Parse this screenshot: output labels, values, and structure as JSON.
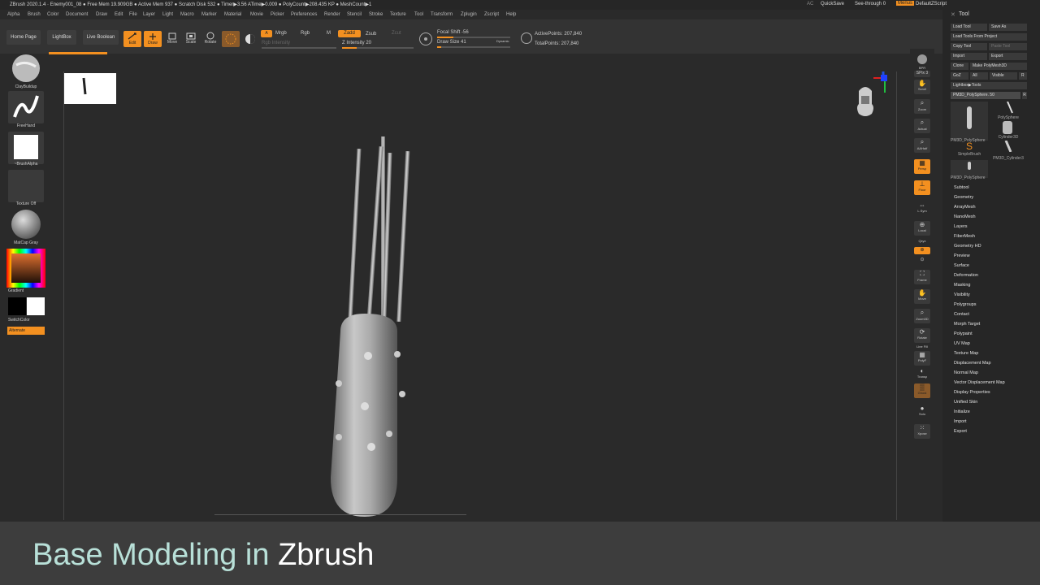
{
  "titlebar": {
    "text": "ZBrush 2020.1.4  ·  Enemy001_08  ●  Free Mem 19.909GB  ●  Active Mem 937  ●  Scratch Disk 532  ●  Timer▶3.56 ATime▶0.009  ●  PolyCount▶208.435 KP  ●  MeshCount▶1",
    "ac": "AC",
    "quicksave": "QuickSave",
    "seethrough": "See-through  0",
    "menus": "Menus",
    "script": "DefaultZScript"
  },
  "menubar": [
    "Alpha",
    "Brush",
    "Color",
    "Document",
    "Draw",
    "Edit",
    "File",
    "Layer",
    "Light",
    "Macro",
    "Marker",
    "Material",
    "Movie",
    "Picker",
    "Preferences",
    "Render",
    "Stencil",
    "Stroke",
    "Texture",
    "Tool",
    "Transform",
    "Zplugin",
    "Zscript",
    "Help"
  ],
  "toolbar": {
    "home": "Home Page",
    "lightbox": "LightBox",
    "liveboolean": "Live Boolean",
    "edit": "Edit",
    "draw": "Draw",
    "move": "Move",
    "scale": "Scale",
    "rotate": "Rotate",
    "a": "A",
    "mrgb": "Mrgb",
    "rgb": "Rgb",
    "m": "M",
    "zadd": "Zadd",
    "zsub": "Zsub",
    "zcut": "Zcut",
    "rgb_intensity": "Rgb Intensity",
    "z_intensity": "Z Intensity 20",
    "focal_shift": "Focal Shift -56",
    "draw_size": "Draw Size 41",
    "dynamic": "Dynamic",
    "active_points": "ActivePoints: 207,840",
    "total_points": "TotalPoints: 207,840",
    "z_intensity_value": 0.2,
    "focal_shift_value": 0.22,
    "draw_size_value": 0.05
  },
  "leftshelf": {
    "brush1": "ClayBuildup",
    "brush2": "FreeHand",
    "alpha": "~BrushAlpha",
    "texture": "Texture Off",
    "material": "MatCap Gray",
    "gradient": "Gradient",
    "switchcolor": "SwitchColor",
    "alternate": "Alternate"
  },
  "rightshelf": {
    "bpr": "BPR",
    "spix": "SPix 3",
    "scroll": "Scroll",
    "zoom": "Zoom",
    "actual": "Actual",
    "aahalf": "AAHalf",
    "persp": "Persp",
    "floor": "Floor",
    "lsym": "L.Sym",
    "local": "Local",
    "qxyz": "Qxyz",
    "frame": "Frame",
    "move": "Move",
    "zoom3d": "Zoom3D",
    "rotate": "Rotate",
    "linefill": "Line Fill",
    "polyf": "PolyF",
    "transp": "Transp",
    "ghost": "Ghost",
    "solo": "Solo",
    "xpose": "Xpose"
  },
  "toolpanel": {
    "title": "Tool",
    "load_tool": "Load Tool",
    "save_as": "Save As",
    "load_from_project": "Load Tools From Project",
    "copy_tool": "Copy Tool",
    "paste_tool": "Paste Tool",
    "import": "Import",
    "export": "Export",
    "clone": "Clone",
    "make_polymesh": "Make PolyMesh3D",
    "goz": "GoZ",
    "all": "All",
    "visible": "Visible",
    "r": "R",
    "lightbox_tools": "Lightbox▶Tools",
    "current_tool": "PM3D_PolySphere. 50",
    "thumbs": [
      "PM3D_PolySphere",
      "PolySphere",
      "Cylinder3D",
      "SimpleBrush",
      "PM3D_Cylinder3",
      "PM3D_PolySphere"
    ],
    "menu": [
      "Subtool",
      "Geometry",
      "ArrayMesh",
      "NanoMesh",
      "Layers",
      "FiberMesh",
      "Geometry HD",
      "Preview",
      "Surface",
      "Deformation",
      "Masking",
      "Visibility",
      "Polygroups",
      "Contact",
      "Morph Target",
      "Polypaint",
      "UV Map",
      "Texture Map",
      "Displacement Map",
      "Normal Map",
      "Vector Displacement Map",
      "Display Properties",
      "Unified Skin",
      "Initialize",
      "Import",
      "Export"
    ]
  },
  "caption": {
    "part1": "Base Modeling in",
    "part2": "Zbrush"
  }
}
